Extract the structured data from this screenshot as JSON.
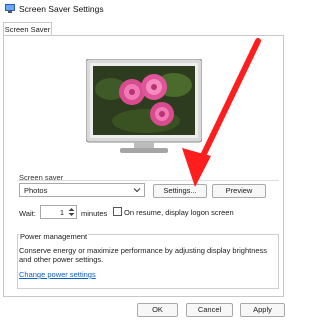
{
  "window": {
    "title": "Screen Saver Settings"
  },
  "tabs": [
    {
      "label": "Screen Saver"
    }
  ],
  "screen_saver": {
    "group_label": "Screen saver",
    "selected": "Photos",
    "settings_label": "Settings...",
    "preview_label": "Preview",
    "wait_label": "Wait:",
    "wait_value": "1",
    "minutes_label": "minutes",
    "resume_label": "On resume, display logon screen"
  },
  "power_management": {
    "title": "Power management",
    "description": "Conserve energy or maximize performance by adjusting display brightness and other power settings.",
    "link": "Change power settings"
  },
  "footer": {
    "ok": "OK",
    "cancel": "Cancel",
    "apply": "Apply"
  },
  "colors": {
    "accent_arrow": "#ff1e1e",
    "link": "#0b5ec8",
    "flower": "#e0559a"
  },
  "icons": [
    "app-icon",
    "chevron-down-icon",
    "spin-up-icon",
    "spin-down-icon",
    "red-arrow-annotation"
  ]
}
